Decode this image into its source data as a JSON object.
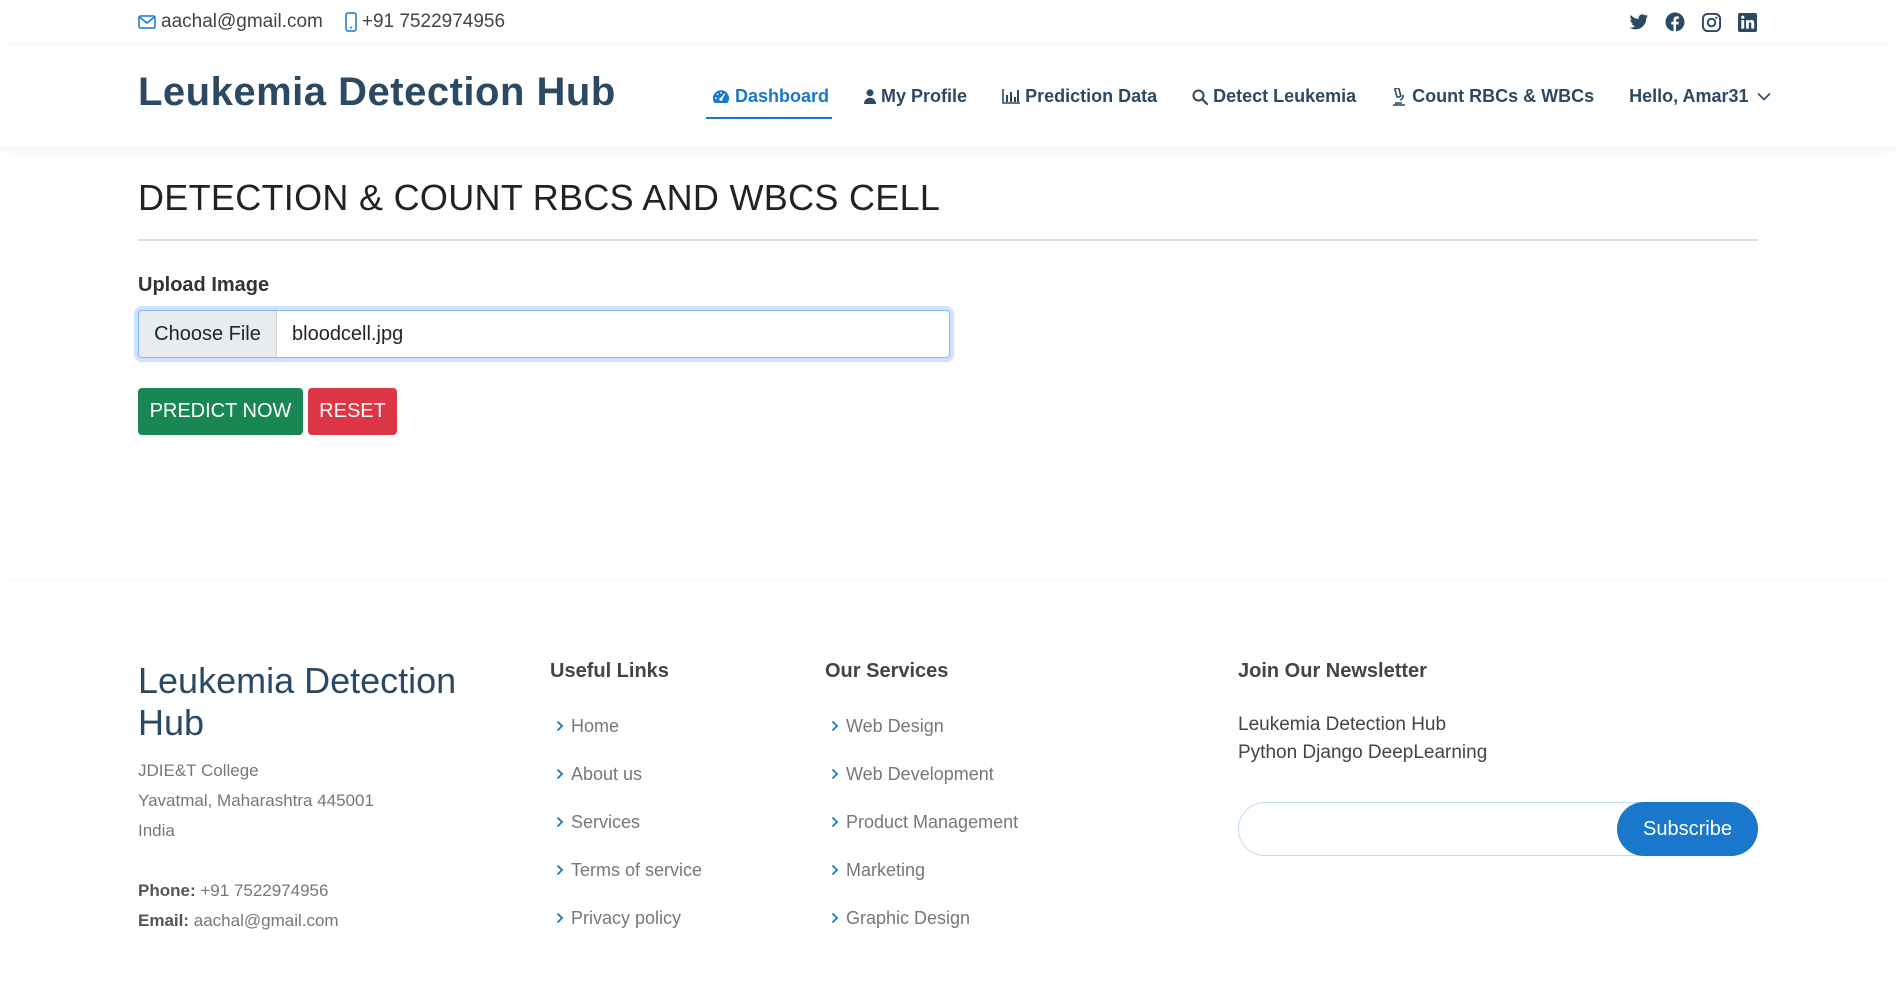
{
  "topbar": {
    "email": "aachal@gmail.com",
    "phone": "+91 7522974956",
    "social": [
      "twitter-icon",
      "facebook-icon",
      "instagram-icon",
      "linkedin-icon"
    ]
  },
  "header": {
    "logo": "Leukemia Detection Hub",
    "nav": [
      {
        "label": "Dashboard",
        "icon": "dashboard-icon",
        "active": true
      },
      {
        "label": "My Profile",
        "icon": "user-icon"
      },
      {
        "label": "Prediction Data",
        "icon": "bar-chart-icon"
      },
      {
        "label": "Detect Leukemia",
        "icon": "search-icon"
      },
      {
        "label": "Count RBCs & WBCs",
        "icon": "microscope-icon"
      }
    ],
    "user_menu": "Hello, Amar31"
  },
  "main": {
    "title": "DETECTION & COUNT RBCS AND WBCS CELL",
    "upload_label": "Upload Image",
    "choose_file": "Choose File",
    "file_name": "bloodcell.jpg",
    "predict_button": "PREDICT NOW",
    "reset_button": "RESET"
  },
  "footer": {
    "brand": "Leukemia Detection Hub",
    "address": [
      "JDIE&T College",
      "Yavatmal, Maharashtra 445001",
      "India"
    ],
    "phone_label": "Phone:",
    "phone": "+91 7522974956",
    "email_label": "Email:",
    "email": "aachal@gmail.com",
    "useful_links": {
      "title": "Useful Links",
      "links": [
        "Home",
        "About us",
        "Services",
        "Terms of service",
        "Privacy policy"
      ]
    },
    "services": {
      "title": "Our Services",
      "links": [
        "Web Design",
        "Web Development",
        "Product Management",
        "Marketing",
        "Graphic Design"
      ]
    },
    "newsletter": {
      "title": "Join Our Newsletter",
      "line1": "Leukemia Detection Hub",
      "line2": "Python Django DeepLearning",
      "input_value": "",
      "subscribe": "Subscribe"
    }
  },
  "colors": {
    "accent": "#1977cc",
    "brand_dark": "#2c4964",
    "success": "#198754",
    "danger": "#dc3545"
  }
}
